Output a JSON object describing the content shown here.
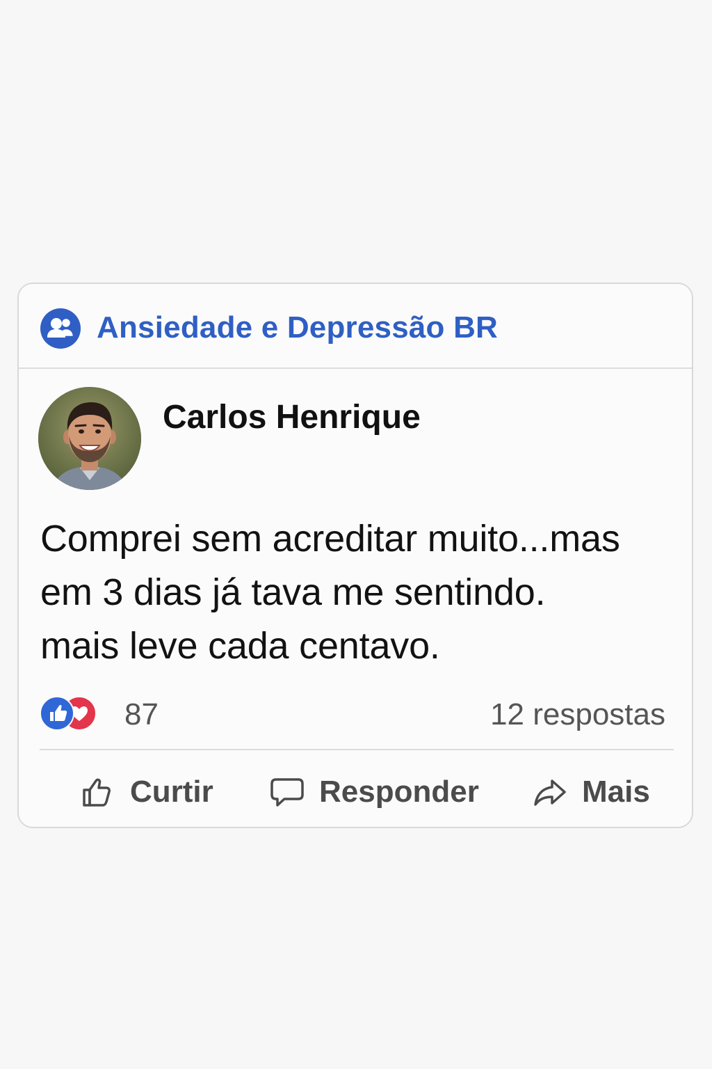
{
  "group": {
    "name": "Ansiedade e Depressão BR",
    "icon": "group-people-icon",
    "accent_color": "#2f5fc4"
  },
  "post": {
    "author": {
      "name": "Carlos Henrique",
      "avatar": "profile-photo"
    },
    "text": "Comprei sem acreditar muito...mas\nem 3 dias já tava me sentindo.\nmais leve cada centavo.",
    "reactions": {
      "types": [
        "like",
        "love"
      ],
      "count": "87",
      "like_color": "#2f67d6",
      "love_color": "#e3354b"
    },
    "replies_label": "12 respostas"
  },
  "actions": {
    "like_label": "Curtir",
    "reply_label": "Responder",
    "more_label": "Mais"
  }
}
